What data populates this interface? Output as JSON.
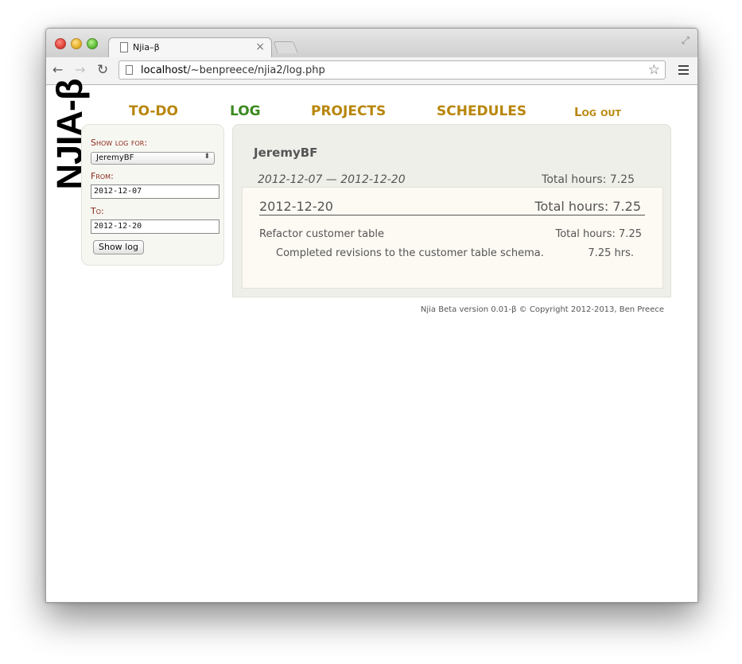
{
  "browser": {
    "tab_title": "Njia–β",
    "tab_close": "×",
    "url_host": "localhost",
    "url_path": "/~benpreece/njia2/log.php",
    "back_icon": "←",
    "forward_icon": "→",
    "reload_icon": "↻",
    "star_icon": "☆",
    "fullscreen_icon": "⤢"
  },
  "logo": "NJIA-β",
  "nav": {
    "todo": "TO-DO",
    "log": "LOG",
    "projects": "PROJECTS",
    "schedules": "SCHEDULES",
    "logout": "Log out"
  },
  "sidebar": {
    "show_log_label": "Show log for:",
    "user_select": "JeremyBF",
    "from_label": "From:",
    "from_value": "2012-12-07",
    "to_label": "To:",
    "to_value": "2012-12-20",
    "show_button": "Show log"
  },
  "log": {
    "user": "JeremyBF",
    "range": "2012-12-07 — 2012-12-20",
    "range_total": "Total hours: 7.25",
    "day": {
      "date": "2012-12-20",
      "total": "Total hours: 7.25",
      "task": "Refactor customer table",
      "task_total": "Total hours: 7.25",
      "entry_desc": "Completed revisions to the customer table schema.",
      "entry_hours": "7.25 hrs."
    }
  },
  "footer": "Njia Beta version 0.01-β © Copyright 2012-2013, Ben Preece"
}
